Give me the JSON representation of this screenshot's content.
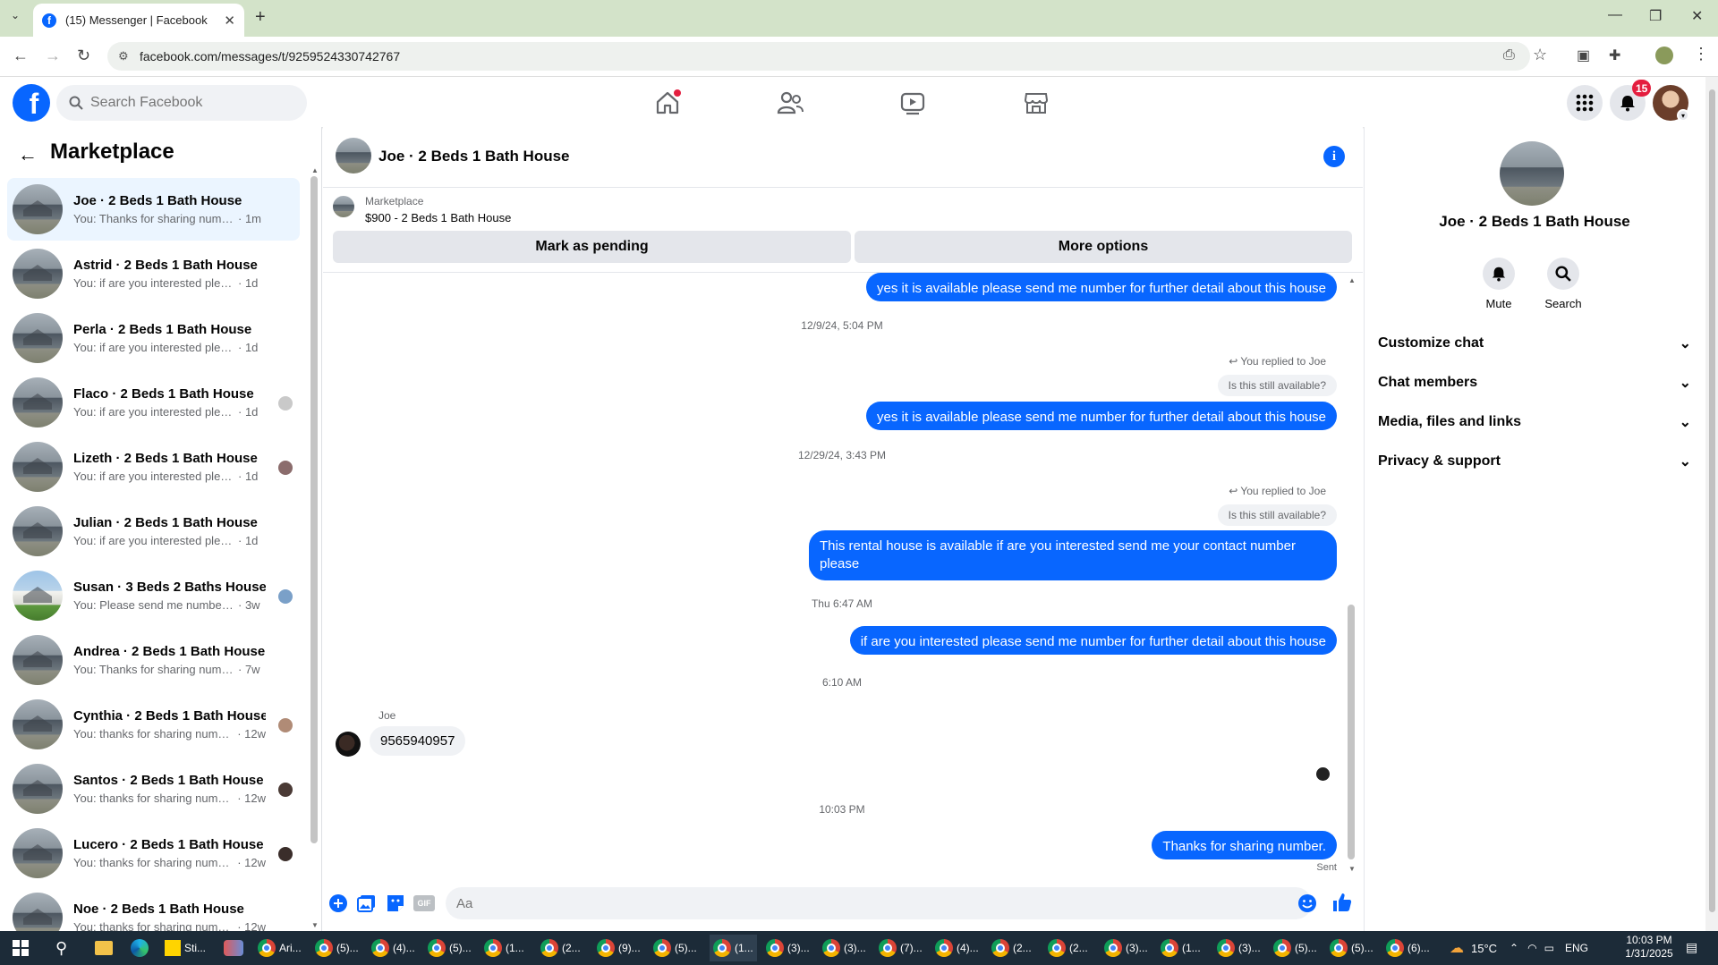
{
  "browser": {
    "tab_title": "(15) Messenger | Facebook",
    "url": "facebook.com/messages/t/9259524330742767"
  },
  "fb": {
    "search_placeholder": "Search Facebook",
    "notification_count": "15"
  },
  "sidebar": {
    "title": "Marketplace",
    "conversations": [
      {
        "name": "Joe · 2 Beds 1 Bath House",
        "preview": "You: Thanks for sharing number.",
        "time": "· 1m",
        "active": true
      },
      {
        "name": "Astrid · 2 Beds 1 Bath House",
        "preview": "You: if are you interested please se...",
        "time": "· 1d"
      },
      {
        "name": "Perla · 2 Beds 1 Bath House",
        "preview": "You: if are you interested please se...",
        "time": "· 1d"
      },
      {
        "name": "Flaco · 2 Beds 1 Bath House",
        "preview": "You: if are you interested please ...",
        "time": "· 1d"
      },
      {
        "name": "Lizeth · 2 Beds 1 Bath House",
        "preview": "You: if are you interested please ...",
        "time": "· 1d"
      },
      {
        "name": "Julian · 2 Beds 1 Bath House",
        "preview": "You: if are you interested please se...",
        "time": "· 1d"
      },
      {
        "name": "Susan · 3 Beds 2 Baths House",
        "preview": "You: Please send me number fo...",
        "time": "· 3w"
      },
      {
        "name": "Andrea · 2 Beds 1 Bath House",
        "preview": "You: Thanks for sharing number.",
        "time": "· 7w"
      },
      {
        "name": "Cynthia · 2 Beds 1 Bath House",
        "preview": "You: thanks for sharing number",
        "time": "· 12w"
      },
      {
        "name": "Santos · 2 Beds 1 Bath House",
        "preview": "You: thanks for sharing number",
        "time": "· 12w"
      },
      {
        "name": "Lucero · 2 Beds 1 Bath House",
        "preview": "You: thanks for sharing number",
        "time": "· 12w"
      },
      {
        "name": "Noe · 2 Beds 1 Bath House",
        "preview": "You: thanks for sharing number",
        "time": "· 12w"
      }
    ]
  },
  "chat": {
    "title": "Joe · 2 Beds 1 Bath House",
    "marketplace_label": "Marketplace",
    "listing": "$900 - 2 Beds 1 Bath House",
    "mark_pending": "Mark as pending",
    "more_options": "More options",
    "messages": {
      "m1": "yes it is available please send me number for further detail about this house",
      "ts1": "12/9/24, 5:04 PM",
      "reply1_hint": "You replied to Joe",
      "reply1_quote": "Is this still available?",
      "m2": "yes it is available please send me number for further detail about this house",
      "ts2": "12/29/24, 3:43 PM",
      "reply2_hint": "You replied to Joe",
      "reply2_quote": "Is this still available?",
      "m3": "This  rental house is available if are you interested  send me your contact number please",
      "ts3": "Thu 6:47 AM",
      "m4": "if are you interested  please send me number for further detail about this house",
      "ts4": "6:10 AM",
      "sender": "Joe",
      "incoming": "9565940957",
      "ts5": "10:03 PM",
      "m5": "Thanks for sharing number.",
      "status": "Sent"
    },
    "composer_placeholder": "Aa",
    "composer_gif": "GIF"
  },
  "details": {
    "name": "Joe · 2 Beds 1 Bath House",
    "mute": "Mute",
    "search": "Search",
    "sections": [
      "Customize chat",
      "Chat members",
      "Media, files and links",
      "Privacy & support"
    ]
  },
  "taskbar": {
    "pinned_labels": [
      "Sti...",
      "Ari..."
    ],
    "chrome_windows": [
      "(5)...",
      "(4)...",
      "(5)...",
      "(1...",
      "(2...",
      "(9)...",
      "(5)...",
      "(1...",
      "(3)...",
      "(3)...",
      "(7)...",
      "(4)...",
      "(2...",
      "(2...",
      "(3)...",
      "(1...",
      "(3)...",
      "(5)...",
      "(5)...",
      "(6)..."
    ],
    "temperature": "15°C",
    "language": "ENG",
    "time": "10:03 PM",
    "date": "1/31/2025"
  }
}
